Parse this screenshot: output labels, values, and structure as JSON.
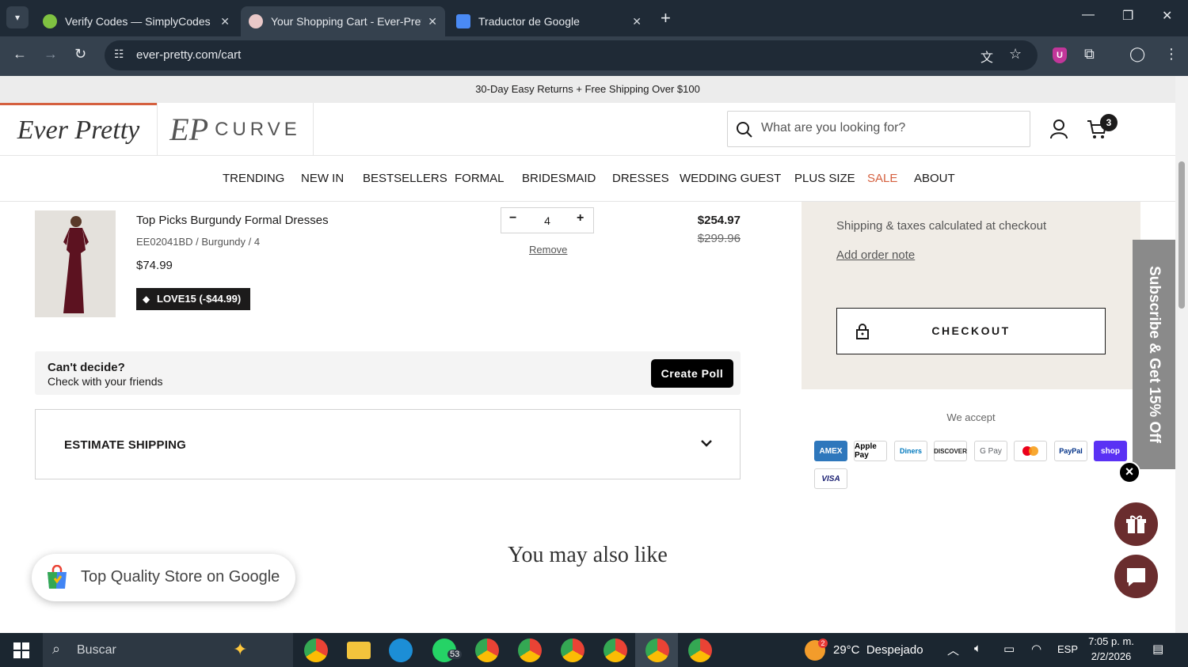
{
  "browser": {
    "tabs": [
      {
        "title": "Verify Codes — SimplyCodes",
        "active": false
      },
      {
        "title": "Your Shopping Cart - Ever-Pretty",
        "active": true
      },
      {
        "title": "Traductor de Google",
        "active": false
      }
    ],
    "url": "ever-pretty.com/cart"
  },
  "announcement": "30-Day Easy Returns + Free Shipping Over $100",
  "header": {
    "logo_main": "Ever Pretty",
    "logo_curve_mark": "EP",
    "logo_curve_text": "CURVE",
    "search_placeholder": "What are you looking for?",
    "cart_count": "3"
  },
  "nav": [
    "TRENDING",
    "NEW IN",
    "BESTSELLERS",
    "FORMAL",
    "BRIDESMAID",
    "DRESSES",
    "WEDDING GUEST",
    "PLUS SIZE",
    "SALE",
    "ABOUT"
  ],
  "cart_item": {
    "name": "Top Picks Burgundy Formal Dresses",
    "variant": "EE02041BD / Burgundy / 4",
    "unit_price": "$74.99",
    "discount": "LOVE15 (-$44.99)",
    "quantity": "4",
    "remove": "Remove",
    "line_price": "$254.97",
    "original_price": "$299.96"
  },
  "poll": {
    "heading": "Can't decide?",
    "subtext": "Check with your friends",
    "button": "Create Poll"
  },
  "estimate_shipping": "ESTIMATE SHIPPING",
  "summary": {
    "taxes_note": "Shipping & taxes calculated at checkout",
    "add_note": "Add order note",
    "checkout": "CHECKOUT"
  },
  "payments": {
    "label": "We accept",
    "methods": [
      "AMEX",
      "Apple Pay",
      "Diners",
      "DISCOVER",
      "G Pay",
      "Mastercard",
      "PayPal",
      "shop",
      "VISA"
    ]
  },
  "subscribe_tab": "Subscribe & Get 15% Off",
  "section_title": "You may also like",
  "google_badge": "Top Quality Store on Google",
  "taskbar": {
    "search": "Buscar",
    "whatsapp_badge": "53",
    "weather_badge": "2",
    "weather": "29°C  Despejado",
    "lang": "ESP",
    "time": "7:05 p. m.",
    "date": "2/2/2026"
  },
  "colors": {
    "sale": "#d5603f",
    "summary_bg": "#f0ece6",
    "tab_bar": "#1f2a36",
    "brand_burgundy": "#6a2d2e"
  }
}
